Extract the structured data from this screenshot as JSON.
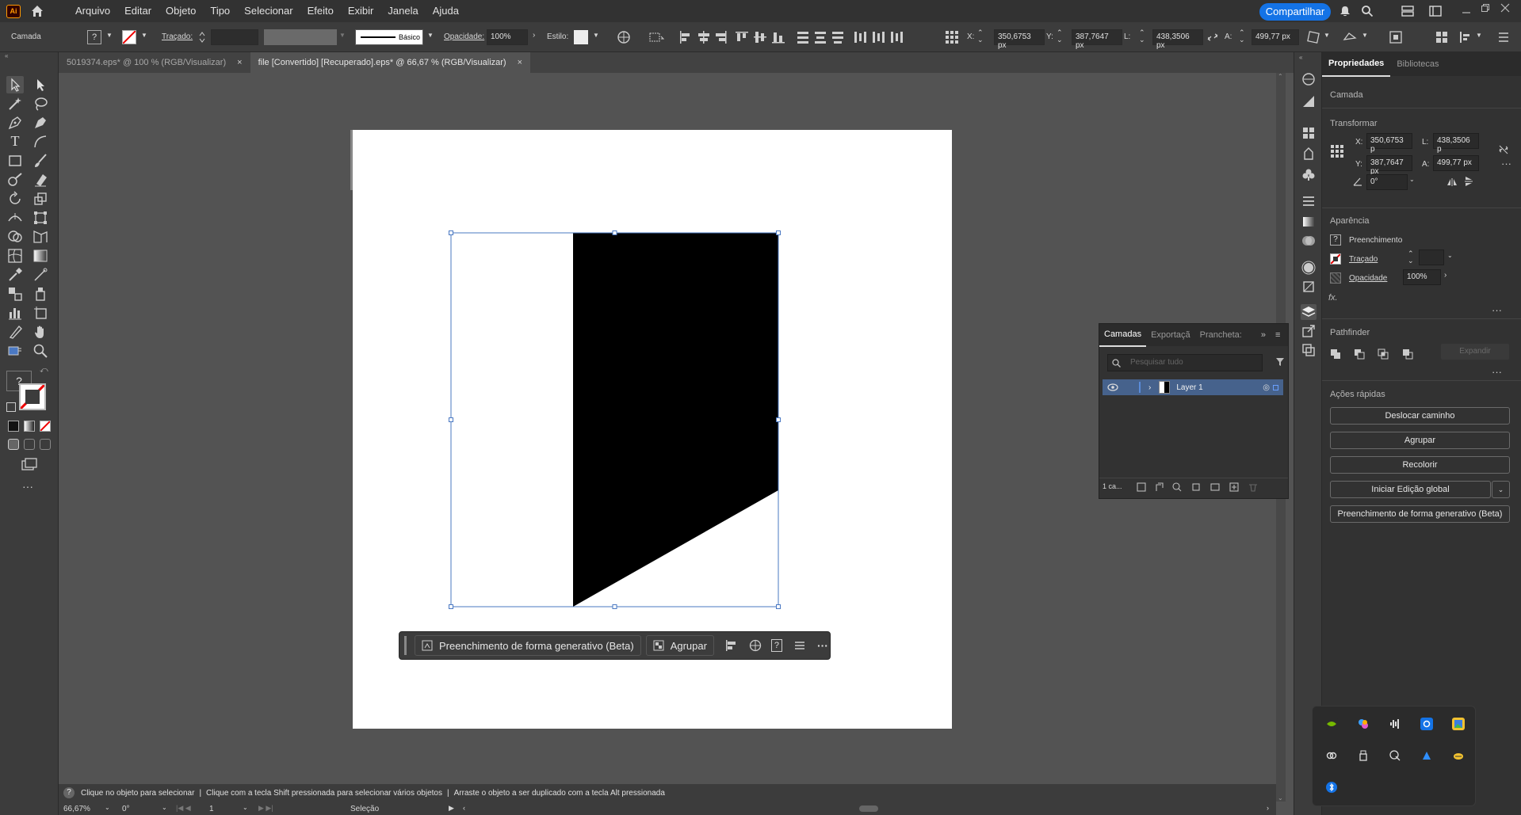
{
  "menubar": {
    "logo": "Ai",
    "items": [
      "Arquivo",
      "Editar",
      "Objeto",
      "Tipo",
      "Selecionar",
      "Efeito",
      "Exibir",
      "Janela",
      "Ajuda"
    ],
    "share_label": "Compartilhar"
  },
  "controlbar": {
    "layer_label": "Camada",
    "stroke_label": "Traçado:",
    "brush_label": "Básico",
    "opacity_label": "Opacidade:",
    "opacity_value": "100%",
    "style_label": "Estilo:",
    "x_label": "X:",
    "x_value": "350,6753 px",
    "y_label": "Y:",
    "y_value": "387,7647 px",
    "w_label": "L:",
    "w_value": "438,3506 px",
    "h_label": "A:",
    "h_value": "499,77 px"
  },
  "tabs": [
    {
      "label": "5019374.eps* @ 100 % (RGB/Visualizar)",
      "close": "×"
    },
    {
      "label": "file [Convertido] [Recuperado].eps* @ 66,67 % (RGB/Visualizar)",
      "close": "×"
    }
  ],
  "context_bar": {
    "generative_label": "Preenchimento de forma generativo (Beta)",
    "group_label": "Agrupar",
    "help_label": "?",
    "more_label": "···"
  },
  "statusbar": {
    "hint1": "Clique no objeto para selecionar",
    "hint2": "Clique com a tecla Shift pressionada para selecionar vários objetos",
    "hint3": "Arraste o objeto a ser duplicado com a tecla Alt pressionada",
    "zoom": "66,67%",
    "rotation": "0°",
    "artboard": "1",
    "tool": "Seleção"
  },
  "properties": {
    "tab_properties": "Propriedades",
    "tab_libraries": "Bibliotecas",
    "layer_title": "Camada",
    "transform_title": "Transformar",
    "x_label": "X:",
    "x_value": "350,6753 p",
    "y_label": "Y:",
    "y_value": "387,7647 px",
    "w_label": "L:",
    "w_value": "438,3506 p",
    "h_label": "A:",
    "h_value": "499,77 px",
    "angle_value": "0°",
    "appearance_title": "Aparência",
    "fill_label": "Preenchimento",
    "stroke_label": "Traçado",
    "opacity_label": "Opacidade",
    "opacity_value": "100%",
    "fx_label": "fx.",
    "pathfinder_title": "Pathfinder",
    "expand_label": "Expandir",
    "quick_actions_title": "Ações rápidas",
    "quick_actions": [
      "Deslocar caminho",
      "Agrupar",
      "Recolorir",
      "Iniciar Edição global",
      "Preenchimento de forma generativo (Beta)"
    ]
  },
  "layers": {
    "tab_layers": "Camadas",
    "tab_export": "Exportaçã",
    "tab_artboards": "Prancheta:",
    "search_placeholder": "Pesquisar tudo",
    "layer_name": "Layer 1",
    "footer_count": "1 ca..."
  },
  "colors": {
    "selection": "#4a78c2",
    "accent": "#1473e6"
  }
}
